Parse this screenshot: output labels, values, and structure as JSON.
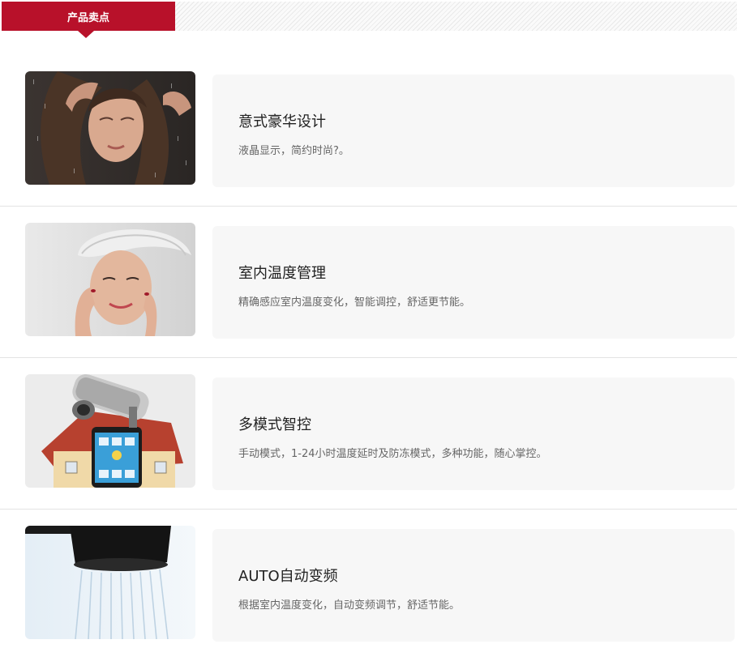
{
  "header": {
    "title": "产品卖点"
  },
  "features": [
    {
      "title": "意式豪华设计",
      "desc": "液晶显示，简约时尚?。",
      "image": "woman-shower-photo"
    },
    {
      "title": "室内温度管理",
      "desc": "精确感应室内温度变化，智能调控，舒适更节能。",
      "image": "woman-towel-photo"
    },
    {
      "title": "多模式智控",
      "desc": "手动模式，1-24小时温度延时及防冻模式，多种功能，随心掌控。",
      "image": "smart-home-camera-photo"
    },
    {
      "title": "AUTO自动变频",
      "desc": "根据室内温度变化，自动变频调节，舒适节能。",
      "image": "shower-head-photo"
    }
  ],
  "colors": {
    "accent": "#b8112a",
    "card_bg": "#f7f7f7"
  }
}
